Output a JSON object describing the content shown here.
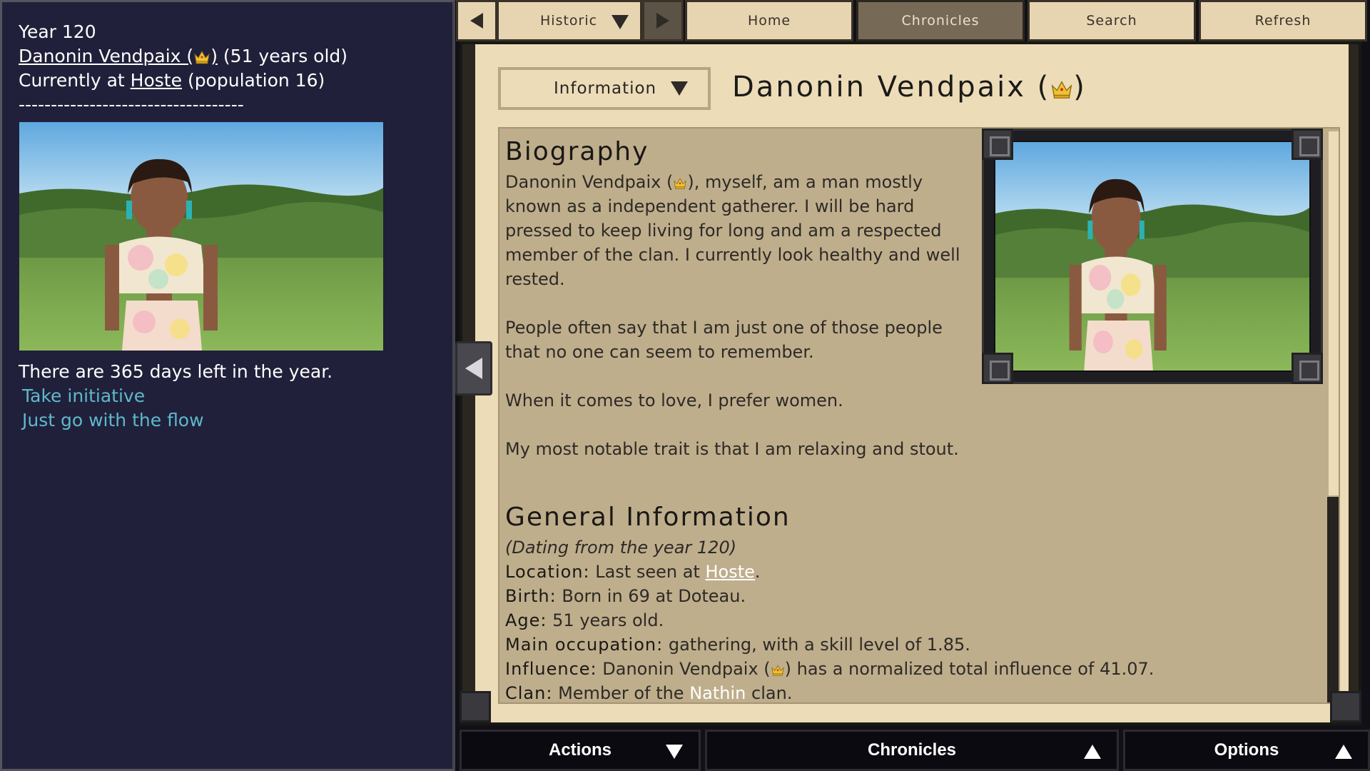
{
  "status": {
    "year": "Year 120",
    "character_name": "Danonin Vendpaix (",
    "character_suffix": ")",
    "age_text": "(51 years old)",
    "location_prefix": "Currently at",
    "location": "Hoste",
    "population": "(population 16)",
    "divider": "-----------------------------------",
    "days_left": "There are 365 days left in the year."
  },
  "choices": [
    "Take initiative",
    "Just go with the flow"
  ],
  "nav": {
    "historic": "Historic",
    "home": "Home",
    "chronicles": "Chronicles",
    "search": "Search",
    "refresh": "Refresh",
    "active_tab": "Chronicles"
  },
  "panel": {
    "dropdown": "Information",
    "title_name": "Danonin Vendpaix (",
    "title_suffix": ")"
  },
  "biography": {
    "heading": "Biography",
    "p1_name": " Danonin Vendpaix (",
    "p1_rest": "), myself, am a man mostly known as a independent gatherer. I will be hard pressed to keep living for long and am a respected member of the clan. I currently look healthy and well rested.",
    "p2": "People often say that I am just one of those people that no one can seem to remember.",
    "p3": "When it comes to love, I prefer women.",
    "p4": "My most notable trait is that I am relaxing and stout."
  },
  "general": {
    "heading": "General Information",
    "dating": "(Dating from the year 120)",
    "location_label": "Location:",
    "location_text": "Last seen at",
    "location_link": "Hoste",
    "location_end": ".",
    "birth_label": "Birth:",
    "birth_text": "Born in 69 at Doteau.",
    "age_label": "Age:",
    "age_text": "51 years old.",
    "occupation_label": "Main occupation:",
    "occupation_text": "gathering, with a skill level of 1.85.",
    "influence_label": "Influence:",
    "influence_name": "Danonin Vendpaix (",
    "influence_text": ") has a normalized total influence of 41.07.",
    "clan_label": "Clan:",
    "clan_text": "Member of the",
    "clan_link": "Nathin",
    "clan_end": "clan."
  },
  "bottom": {
    "actions": "Actions",
    "chronicles": "Chronicles",
    "options": "Options"
  },
  "colors": {
    "choice_link": "#5fb8cc",
    "parchment": "#ecdcb8",
    "content_bg": "#bfae8c",
    "active_tab": "#766a56"
  },
  "icons": {
    "crown": "crown-icon",
    "back": "arrow-left-icon",
    "forward": "arrow-right-icon",
    "dropdown": "chevron-down-icon",
    "collapse": "collapse-left-icon"
  }
}
